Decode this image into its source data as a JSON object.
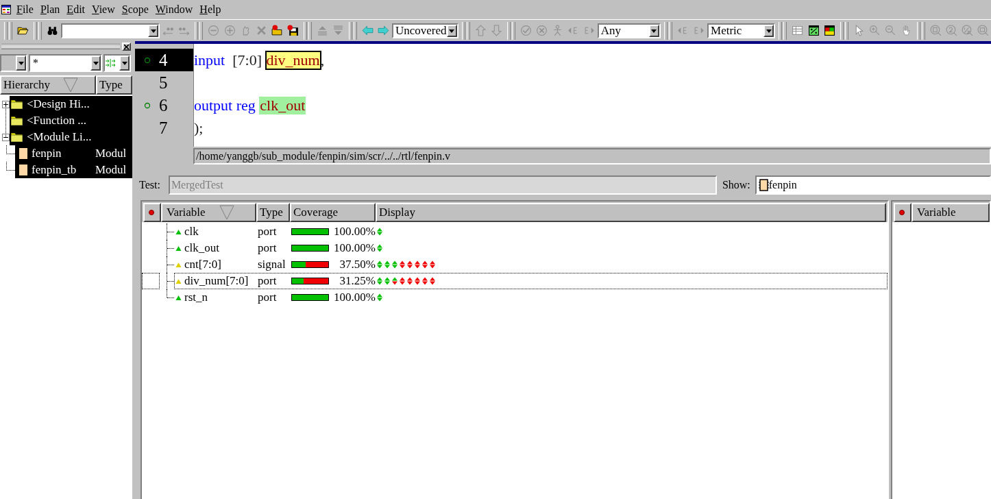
{
  "menu": [
    "File",
    "Plan",
    "Edit",
    "View",
    "Scope",
    "Window",
    "Help"
  ],
  "toolbar": {
    "combos": [
      "Uncovered",
      "Any",
      "Metric"
    ],
    "tool_buttons": [
      {
        "disabled": false
      },
      {
        "disabled": false
      },
      {
        "disabled": true
      },
      {
        "disabled": true
      },
      {
        "disabled": true
      },
      {
        "disabled": true
      },
      {
        "disabled": true
      },
      {
        "disabled": true
      },
      {
        "disabled": false
      },
      {
        "disabled": false
      },
      {
        "disabled": true
      },
      {
        "disabled": true
      },
      {
        "disabled": false
      },
      {
        "disabled": false
      },
      {
        "disabled": true
      },
      {
        "disabled": true
      },
      {
        "disabled": true
      },
      {
        "disabled": true
      },
      {
        "disabled": true
      },
      {
        "disabled": true
      },
      {
        "disabled": true
      },
      {
        "disabled": true
      },
      {
        "disabled": true
      },
      {
        "disabled": true
      },
      {
        "disabled": false
      },
      {
        "disabled": false
      },
      {
        "disabled": true
      },
      {
        "disabled": true
      },
      {
        "disabled": true
      },
      {
        "disabled": true
      },
      {
        "disabled": true
      },
      {
        "disabled": true
      },
      {
        "disabled": true
      },
      {
        "disabled": true
      }
    ]
  },
  "hierarchy": {
    "filter": "*",
    "columns": [
      "Hierarchy",
      "Type"
    ],
    "items": [
      {
        "label": "<Design Hi...",
        "selected": true,
        "expanded": false
      },
      {
        "label": "<Function ...",
        "selected": true
      },
      {
        "label": "<Module Li...",
        "selected": true,
        "expanded": true,
        "children": [
          {
            "label": "fenpin",
            "type": "Modul",
            "selected": true
          },
          {
            "label": "fenpin_tb",
            "type": "Modul",
            "selected": true
          }
        ]
      }
    ]
  },
  "source": {
    "lines": [
      {
        "number": "4",
        "current": true,
        "marker": true,
        "tokens": [
          {
            "kind": "keyword",
            "text": "input"
          },
          {
            "kind": "plain",
            "text": " [7:0] "
          },
          {
            "kind": "signal",
            "text": "div_num",
            "color": "#ffff80",
            "boxed": true
          },
          {
            "kind": "plain",
            "text": ","
          }
        ]
      },
      {
        "number": "5",
        "current": false,
        "marker": false
      },
      {
        "number": "6",
        "current": false,
        "marker": true,
        "tokens": [
          {
            "kind": "keyword",
            "text": "output reg"
          },
          {
            "kind": "signal",
            "text": "clk_out",
            "color": "#a0f0a0",
            "boxed": false
          }
        ]
      },
      {
        "number": "7",
        "current": false,
        "marker": false,
        "tokens": [
          {
            "kind": "plain",
            "text": ");"
          }
        ]
      }
    ],
    "path": "/home/yanggb/sub_module/fenpin/sim/scr/../../rtl/fenpin.v"
  },
  "coverage": {
    "test_label": "Test:",
    "test_value": "MergedTest",
    "test_disabled": true,
    "show_label": "Show:",
    "show_value": "fenpin",
    "columns": [
      "Variable",
      "Type",
      "Coverage",
      "Display"
    ],
    "rows": [
      {
        "name": "clk",
        "type": "port",
        "color": "#00c000",
        "level": 1,
        "percent": "100.00%",
        "selected": false,
        "bits": [
          {
            "up": true,
            "down": true
          }
        ]
      },
      {
        "name": "clk_out",
        "type": "port",
        "color": "#00c000",
        "level": 1,
        "percent": "100.00%",
        "selected": false,
        "bits": [
          {
            "up": true,
            "down": true
          }
        ]
      },
      {
        "name": "cnt[7:0]",
        "type": "signal",
        "color": "#e0d000",
        "level": 0.375,
        "percent": "37.50%",
        "selected": false,
        "bits": [
          {
            "up": true,
            "down": true
          },
          {
            "up": true,
            "down": true
          },
          {
            "up": true,
            "down": true
          },
          {
            "up": false,
            "down": false
          },
          {
            "up": false,
            "down": false
          },
          {
            "up": false,
            "down": false
          },
          {
            "up": false,
            "down": false
          },
          {
            "up": false,
            "down": false
          }
        ]
      },
      {
        "name": "div_num[7:0]",
        "type": "port",
        "color": "#e0d000",
        "level": 0.3125,
        "percent": "31.25%",
        "selected": true,
        "bits": [
          {
            "up": true,
            "down": true
          },
          {
            "up": true,
            "down": true
          },
          {
            "up": true,
            "down": false
          },
          {
            "up": false,
            "down": false
          },
          {
            "up": false,
            "down": false
          },
          {
            "up": false,
            "down": false
          },
          {
            "up": false,
            "down": false
          },
          {
            "up": false,
            "down": false
          }
        ]
      },
      {
        "name": "rst_n",
        "type": "port",
        "color": "#00c000",
        "level": 1,
        "percent": "100.00%",
        "selected": false,
        "bits": [
          {
            "up": true,
            "down": true
          }
        ]
      }
    ]
  },
  "side_table": {
    "columns": [
      "Variable"
    ]
  }
}
